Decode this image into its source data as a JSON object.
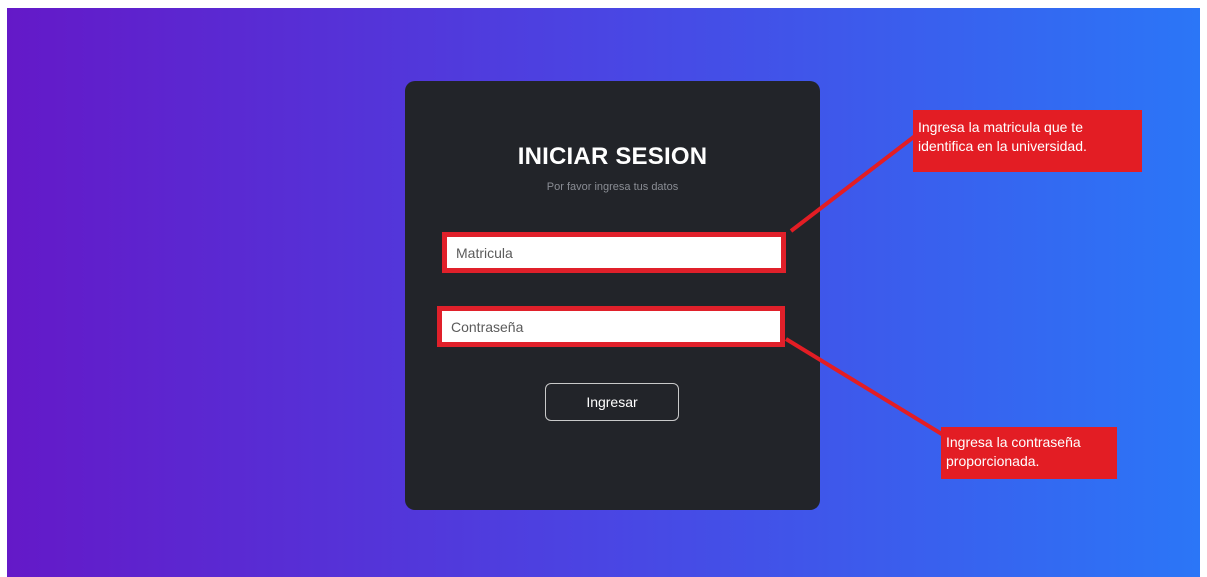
{
  "login": {
    "title": "INICIAR SESION",
    "subtitle": "Por favor ingresa tus datos",
    "username_placeholder": "Matricula",
    "password_placeholder": "Contraseña",
    "submit_label": "Ingresar"
  },
  "annotations": {
    "username_note": "Ingresa la matricula que te identifica en la universidad.",
    "password_note": "Ingresa la contraseña proporcionada."
  },
  "colors": {
    "gradient_start": "#6419c8",
    "gradient_end": "#2b76f7",
    "card_background": "#222429",
    "annotation_red": "#e31d24"
  }
}
